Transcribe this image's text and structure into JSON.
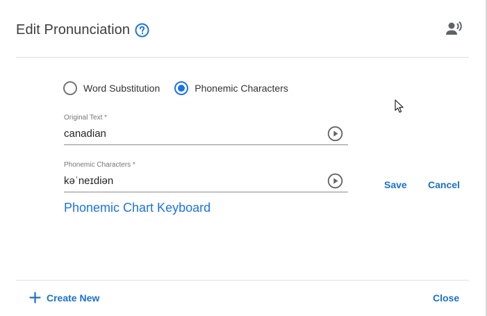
{
  "dialog": {
    "title": "Edit Pronunciation",
    "icons": {
      "help": "help-circle-icon",
      "voice": "record-voice-icon"
    }
  },
  "mode": {
    "options": [
      {
        "label": "Word Substitution",
        "selected": false
      },
      {
        "label": "Phonemic Characters",
        "selected": true
      }
    ]
  },
  "original_text": {
    "label": "Original Text *",
    "value": "canadian"
  },
  "phonemic_characters": {
    "label": "Phonemic Characters *",
    "value": "kəˈneɪdiən"
  },
  "actions": {
    "save": "Save",
    "cancel": "Cancel",
    "phonemic_chart": "Phonemic Chart Keyboard"
  },
  "footer": {
    "create_new": "Create New",
    "close": "Close"
  },
  "colors": {
    "accent": "#1a73e8",
    "link": "#1a6fd1",
    "title": "#3c3c3c",
    "divider": "#e0e0e0"
  }
}
